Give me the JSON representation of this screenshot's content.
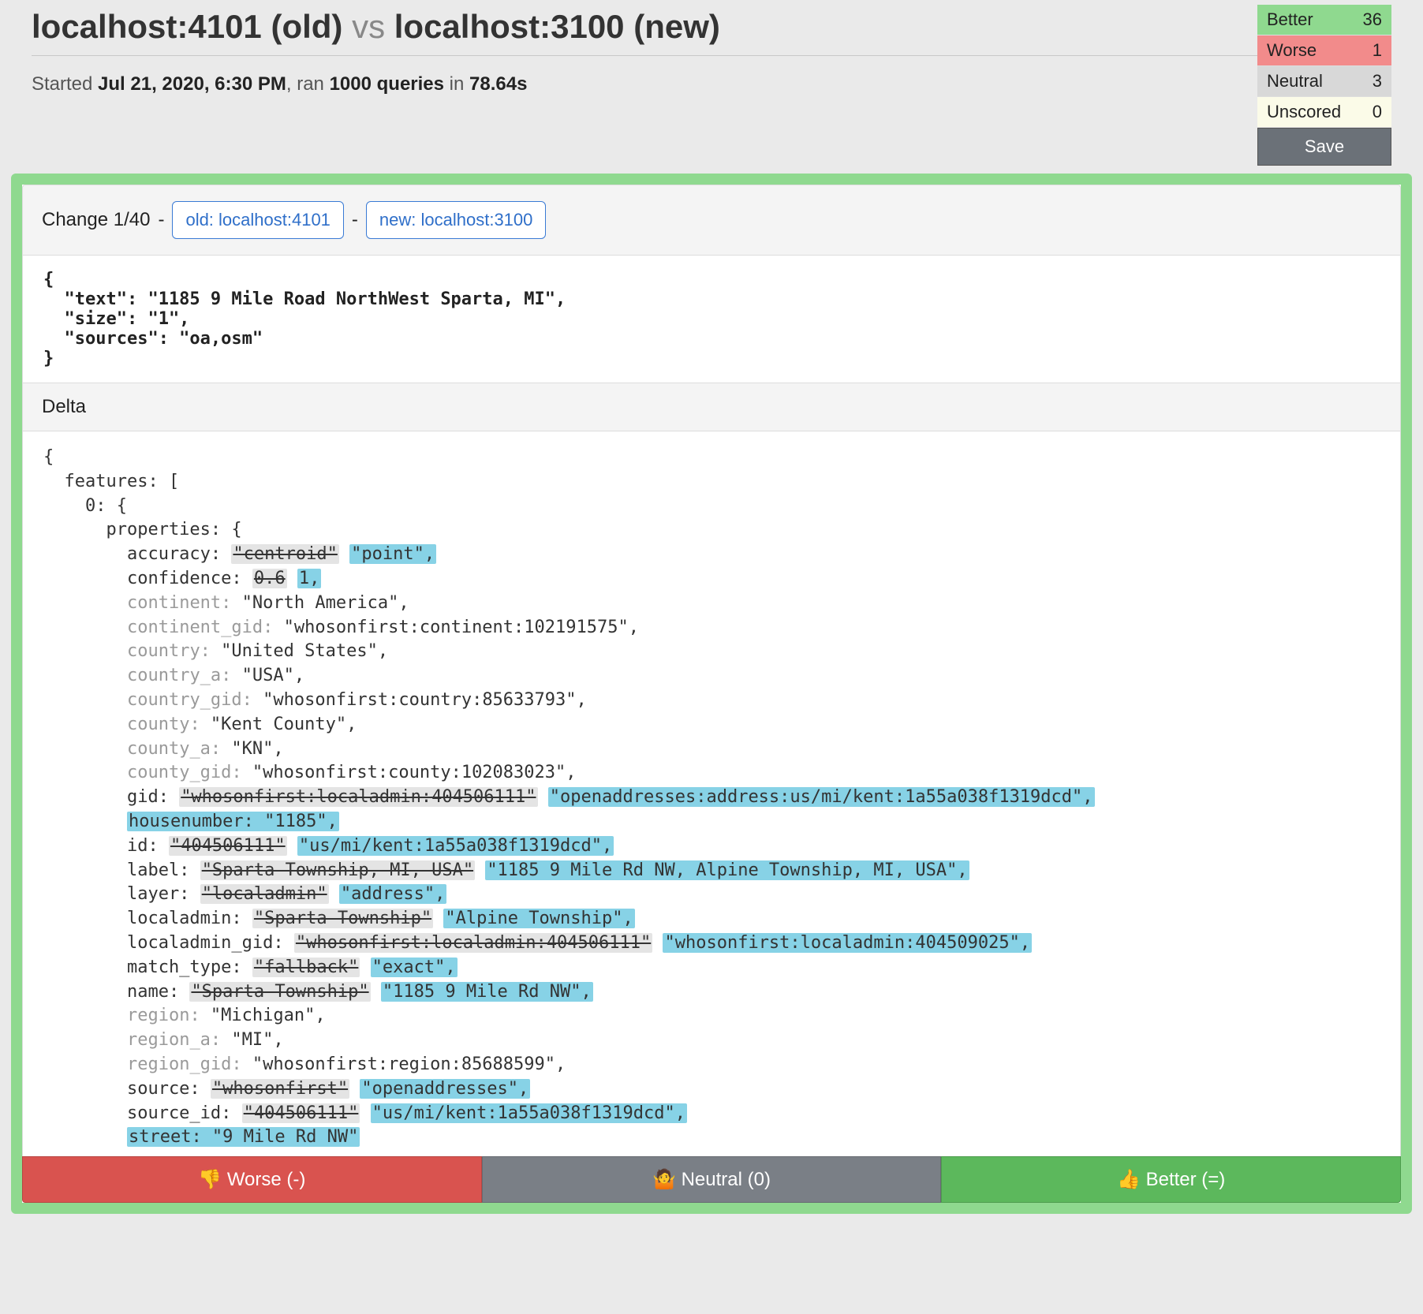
{
  "header": {
    "old_label": "localhost:4101 (old)",
    "vs": "vs",
    "new_label": "localhost:3100 (new)"
  },
  "run": {
    "started_prefix": "Started ",
    "started_at": "Jul 21, 2020, 6:30 PM",
    "ran_mid": ", ran ",
    "query_count": "1000 queries",
    "in": " in ",
    "duration": "78.64s"
  },
  "scores": {
    "better_label": "Better",
    "better_count": 36,
    "worse_label": "Worse",
    "worse_count": 1,
    "neutral_label": "Neutral",
    "neutral_count": 3,
    "unscored_label": "Unscored",
    "unscored_count": 0,
    "save": "Save"
  },
  "change": {
    "label": "Change 1/40",
    "dash1": " - ",
    "old_btn": "old: localhost:4101",
    "dash2": " - ",
    "new_btn": "new: localhost:3100"
  },
  "query_json": "{\n  \"text\": \"1185 9 Mile Road NorthWest Sparta, MI\",\n  \"size\": \"1\",\n  \"sources\": \"oa,osm\"\n}",
  "delta_header": "Delta",
  "delta": {
    "open": "{",
    "features": "  features: [",
    "idx": "    0: {",
    "props": "      properties: {",
    "rows": [
      {
        "key": "accuracy",
        "indent": 8,
        "dim": false,
        "old": "\"centroid\"",
        "new": "\"point\",",
        "plain": null
      },
      {
        "key": "confidence",
        "indent": 8,
        "dim": false,
        "old": "0.6",
        "new": "1,",
        "plain": null
      },
      {
        "key": "continent",
        "indent": 8,
        "dim": true,
        "old": null,
        "new": null,
        "plain": "\"North America\","
      },
      {
        "key": "continent_gid",
        "indent": 8,
        "dim": true,
        "old": null,
        "new": null,
        "plain": "\"whosonfirst:continent:102191575\","
      },
      {
        "key": "country",
        "indent": 8,
        "dim": true,
        "old": null,
        "new": null,
        "plain": "\"United States\","
      },
      {
        "key": "country_a",
        "indent": 8,
        "dim": true,
        "old": null,
        "new": null,
        "plain": "\"USA\","
      },
      {
        "key": "country_gid",
        "indent": 8,
        "dim": true,
        "old": null,
        "new": null,
        "plain": "\"whosonfirst:country:85633793\","
      },
      {
        "key": "county",
        "indent": 8,
        "dim": true,
        "old": null,
        "new": null,
        "plain": "\"Kent County\","
      },
      {
        "key": "county_a",
        "indent": 8,
        "dim": true,
        "old": null,
        "new": null,
        "plain": "\"KN\","
      },
      {
        "key": "county_gid",
        "indent": 8,
        "dim": true,
        "old": null,
        "new": null,
        "plain": "\"whosonfirst:county:102083023\","
      },
      {
        "key": "gid",
        "indent": 8,
        "dim": false,
        "old": "\"whosonfirst:localadmin:404506111\"",
        "new": "\"openaddresses:address:us/mi/kent:1a55a038f1319dcd\",",
        "plain": null
      },
      {
        "key": "housenumber",
        "indent": 8,
        "dim": false,
        "old": null,
        "new": null,
        "newline": "housenumber: \"1185\","
      },
      {
        "key": "id",
        "indent": 8,
        "dim": false,
        "old": "\"404506111\"",
        "new": "\"us/mi/kent:1a55a038f1319dcd\",",
        "plain": null
      },
      {
        "key": "label",
        "indent": 8,
        "dim": false,
        "old": "\"Sparta Township, MI, USA\"",
        "new": "\"1185 9 Mile Rd NW, Alpine Township, MI, USA\",",
        "plain": null
      },
      {
        "key": "layer",
        "indent": 8,
        "dim": false,
        "old": "\"localadmin\"",
        "new": "\"address\",",
        "plain": null
      },
      {
        "key": "localadmin",
        "indent": 8,
        "dim": false,
        "old": "\"Sparta Township\"",
        "new": "\"Alpine Township\",",
        "plain": null
      },
      {
        "key": "localadmin_gid",
        "indent": 8,
        "dim": false,
        "old": "\"whosonfirst:localadmin:404506111\"",
        "new": "\"whosonfirst:localadmin:404509025\",",
        "plain": null
      },
      {
        "key": "match_type",
        "indent": 8,
        "dim": false,
        "old": "\"fallback\"",
        "new": "\"exact\",",
        "plain": null
      },
      {
        "key": "name",
        "indent": 8,
        "dim": false,
        "old": "\"Sparta Township\"",
        "new": "\"1185 9 Mile Rd NW\",",
        "plain": null
      },
      {
        "key": "region",
        "indent": 8,
        "dim": true,
        "old": null,
        "new": null,
        "plain": "\"Michigan\","
      },
      {
        "key": "region_a",
        "indent": 8,
        "dim": true,
        "old": null,
        "new": null,
        "plain": "\"MI\","
      },
      {
        "key": "region_gid",
        "indent": 8,
        "dim": true,
        "old": null,
        "new": null,
        "plain": "\"whosonfirst:region:85688599\","
      },
      {
        "key": "source",
        "indent": 8,
        "dim": false,
        "old": "\"whosonfirst\"",
        "new": "\"openaddresses\",",
        "plain": null
      },
      {
        "key": "source_id",
        "indent": 8,
        "dim": false,
        "old": "\"404506111\"",
        "new": "\"us/mi/kent:1a55a038f1319dcd\",",
        "plain": null
      },
      {
        "key": "street",
        "indent": 8,
        "dim": false,
        "old": null,
        "new": null,
        "newline": "street: \"9 Mile Rd NW\""
      }
    ]
  },
  "votes": {
    "worse": "👎 Worse (-)",
    "neutral": "🤷 Neutral (0)",
    "better": "👍 Better (=)"
  }
}
